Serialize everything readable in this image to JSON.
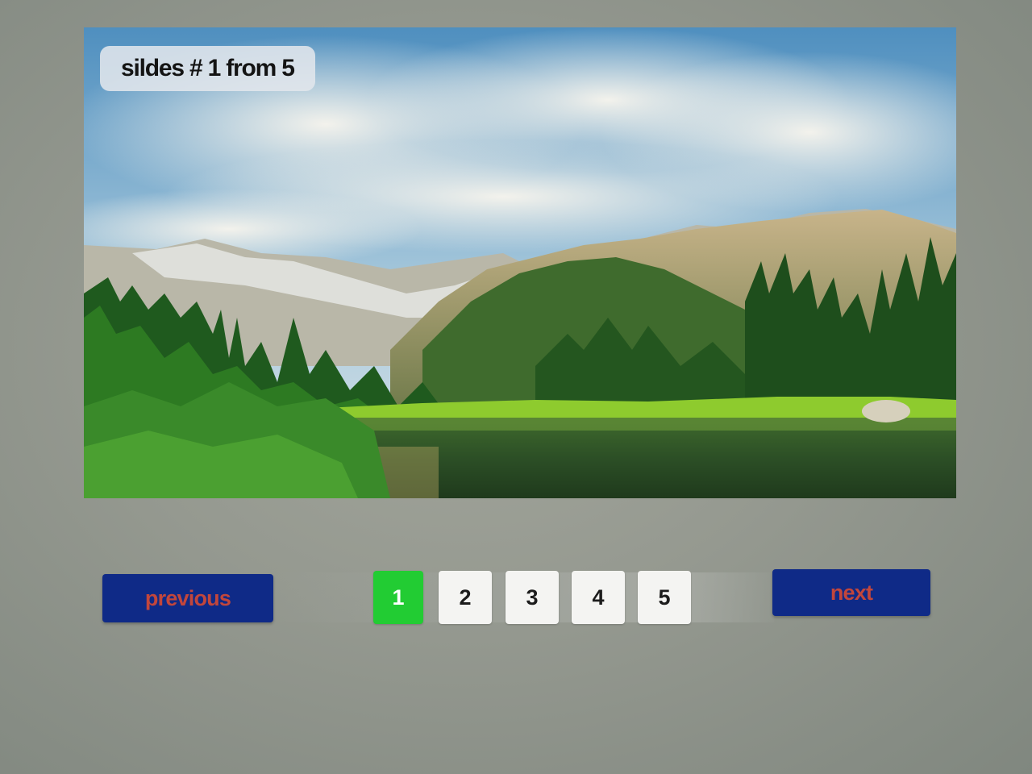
{
  "slider": {
    "counter_text": "sildes # 1 from 5",
    "image_alt": "mountain lake landscape"
  },
  "pagination": {
    "previous_label": "previous",
    "next_label": "next",
    "pages": [
      "1",
      "2",
      "3",
      "4",
      "5"
    ],
    "active_page": "1"
  },
  "colors": {
    "nav_button_bg": "#0f2a87",
    "nav_button_text": "#c2463c",
    "active_page_bg": "#22cc33",
    "page_bg": "#f4f4f2"
  }
}
